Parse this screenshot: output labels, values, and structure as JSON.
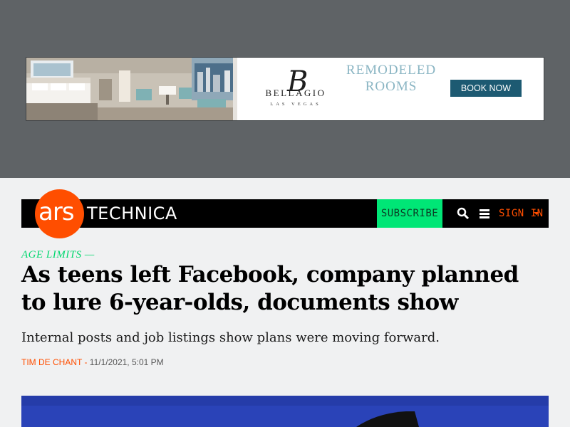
{
  "ad": {
    "brand_initial": "B",
    "brand_name": "BELLAGIO",
    "brand_city": "LAS VEGAS",
    "headline": "REMODELED ROOMS",
    "cta_label": "BOOK NOW"
  },
  "header": {
    "logo_ars": "ars",
    "logo_technica": "TECHNICA",
    "subscribe_label": "SUBSCRIBE",
    "search_icon": "search-icon",
    "menu_icon": "hamburger-menu-icon",
    "signin_label": "SIGN IN"
  },
  "article": {
    "kicker": "AGE LIMITS —",
    "title": "As teens left Facebook, company planned to lure 6-year-olds, documents show",
    "dek": "Internal posts and job listings show plans were moving forward.",
    "author": "TIM DE CHANT",
    "separator": " - ",
    "date": "11/1/2021, 5:01 PM"
  },
  "colors": {
    "brand_orange": "#ff4e00",
    "subscribe_green": "#00e676",
    "kicker_green": "#00d76e",
    "ad_band": "#5f6366",
    "ad_cta": "#1d5a72",
    "hero_sky": "#2a43b8"
  }
}
